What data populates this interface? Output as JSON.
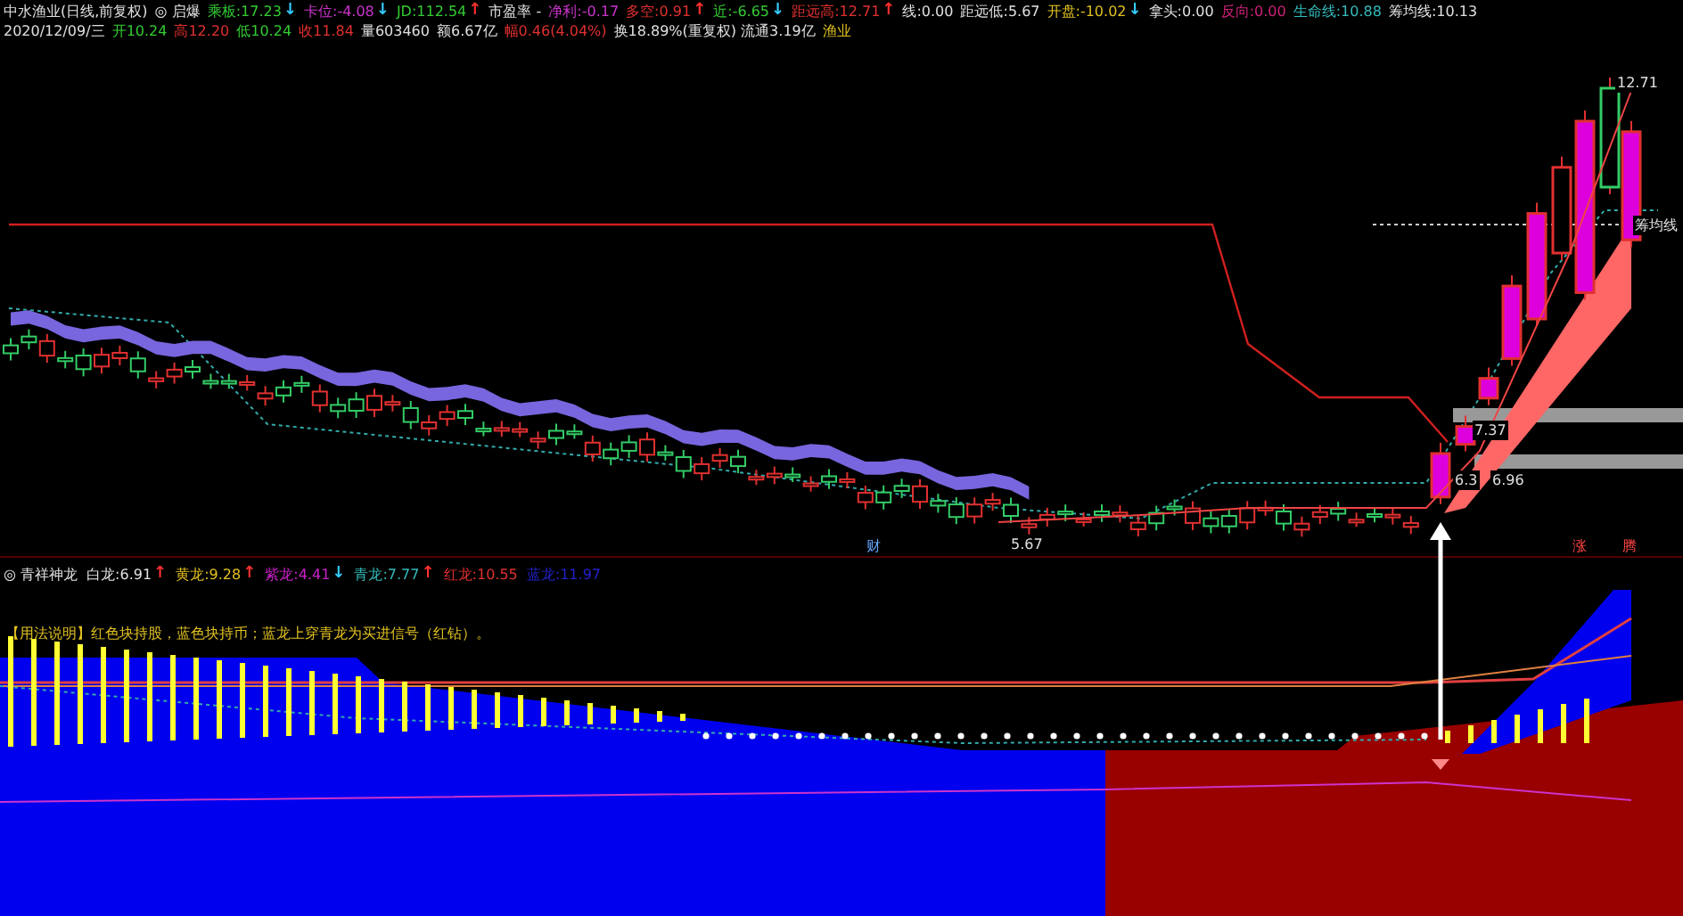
{
  "header": {
    "row1": [
      {
        "label": "中水渔业(日线,前复权)",
        "color": "#e0e0e0"
      },
      {
        "label": "◎ 启爆",
        "color": "#e0e0e0"
      },
      {
        "label": "乘板:",
        "value": "17.23",
        "color": "#33cc33",
        "arrow": {
          "text": "↓",
          "color": "#33ccff"
        }
      },
      {
        "label": "卡位:",
        "value": "-4.08",
        "color": "#cc33cc",
        "arrow": {
          "text": "↓",
          "color": "#33ccff"
        }
      },
      {
        "label": "JD:",
        "value": "112.54",
        "color": "#33cc33",
        "arrow": {
          "text": "↑",
          "color": "#ff3030"
        }
      },
      {
        "label": "市盈率 -",
        "color": "#e0e0e0"
      },
      {
        "label": "净利:",
        "value": "-0.17",
        "color": "#cc33cc"
      },
      {
        "label": "多空:",
        "value": "0.91",
        "color": "#e03030",
        "arrow": {
          "text": "↑",
          "color": "#ff3030"
        }
      },
      {
        "label": "近:",
        "value": "-6.65",
        "color": "#33cc33",
        "arrow": {
          "text": "↓",
          "color": "#33ccff"
        }
      },
      {
        "label": "距远高:",
        "value": "12.71",
        "color": "#e03030",
        "arrow": {
          "text": "↑",
          "color": "#ff3030"
        }
      },
      {
        "label": "线:",
        "value": "0.00",
        "color": "#e0e0e0"
      },
      {
        "label": "距远低:",
        "value": "5.67",
        "color": "#e0e0e0"
      },
      {
        "label": "开盘:",
        "value": "-10.02",
        "color": "#e0c020",
        "arrow": {
          "text": "↓",
          "color": "#33ccff"
        }
      },
      {
        "label": "拿头:",
        "value": "0.00",
        "color": "#e0e0e0"
      },
      {
        "label": "反向:",
        "value": "0.00",
        "color": "#cc2277"
      },
      {
        "label": "生命线:",
        "value": "10.88",
        "color": "#33bbbb"
      },
      {
        "label": "筹均线:",
        "value": "10.13",
        "color": "#e0e0e0"
      }
    ],
    "row2": [
      {
        "label": "2020/12/09/三",
        "color": "#e0e0e0"
      },
      {
        "label": "开",
        "value": "10.24",
        "color": "#33cc33"
      },
      {
        "label": "高",
        "value": "12.20",
        "color": "#e03030"
      },
      {
        "label": "低",
        "value": "10.24",
        "color": "#33cc33"
      },
      {
        "label": "收",
        "value": "11.84",
        "color": "#e03030"
      },
      {
        "label": "量",
        "value": "603460",
        "color": "#e0e0e0"
      },
      {
        "label": "额",
        "value": "6.67亿",
        "color": "#e0e0e0"
      },
      {
        "label": "幅",
        "value": "0.46(4.04%)",
        "color": "#e03030"
      },
      {
        "label": "换",
        "value": "18.89%(重复权) 流通3.19亿",
        "color": "#e0e0e0"
      },
      {
        "label": "渔业",
        "color": "#e0c020"
      }
    ]
  },
  "main_chart": {
    "labels": [
      {
        "text": "12.71",
        "kind": "high"
      },
      {
        "text": "筹均线",
        "kind": "chip"
      },
      {
        "text": "7.37",
        "kind": "level_upper"
      },
      {
        "text": "6.96",
        "kind": "level_lower"
      },
      {
        "text": "6.3",
        "kind": "level_start"
      },
      {
        "text": "5.67",
        "kind": "low"
      }
    ],
    "markers": [
      {
        "text": "财",
        "kind": "left"
      },
      {
        "text": "涨",
        "kind": "mid"
      },
      {
        "text": "腾",
        "kind": "right"
      }
    ]
  },
  "indicator": {
    "title": "◎ 青祥神龙",
    "lines": [
      {
        "label": "白龙:",
        "value": "6.91",
        "color": "#e0e0e0",
        "arrow": {
          "text": "↑",
          "color": "#ff3030"
        }
      },
      {
        "label": "黄龙:",
        "value": "9.28",
        "color": "#e0c020",
        "arrow": {
          "text": "↑",
          "color": "#ff3030"
        }
      },
      {
        "label": "紫龙:",
        "value": "4.41",
        "color": "#cc22cc",
        "arrow": {
          "text": "↓",
          "color": "#33ccff"
        }
      },
      {
        "label": "青龙:",
        "value": "7.77",
        "color": "#33bbbb",
        "arrow": {
          "text": "↑",
          "color": "#ff3030"
        }
      },
      {
        "label": "红龙:",
        "value": "10.55",
        "color": "#e03030"
      },
      {
        "label": "蓝龙:",
        "value": "11.97",
        "color": "#2222cc"
      }
    ],
    "note": "【用法说明】红色块持股，蓝色块持币；蓝龙上穿青龙为买进信号（红钻）。"
  }
}
